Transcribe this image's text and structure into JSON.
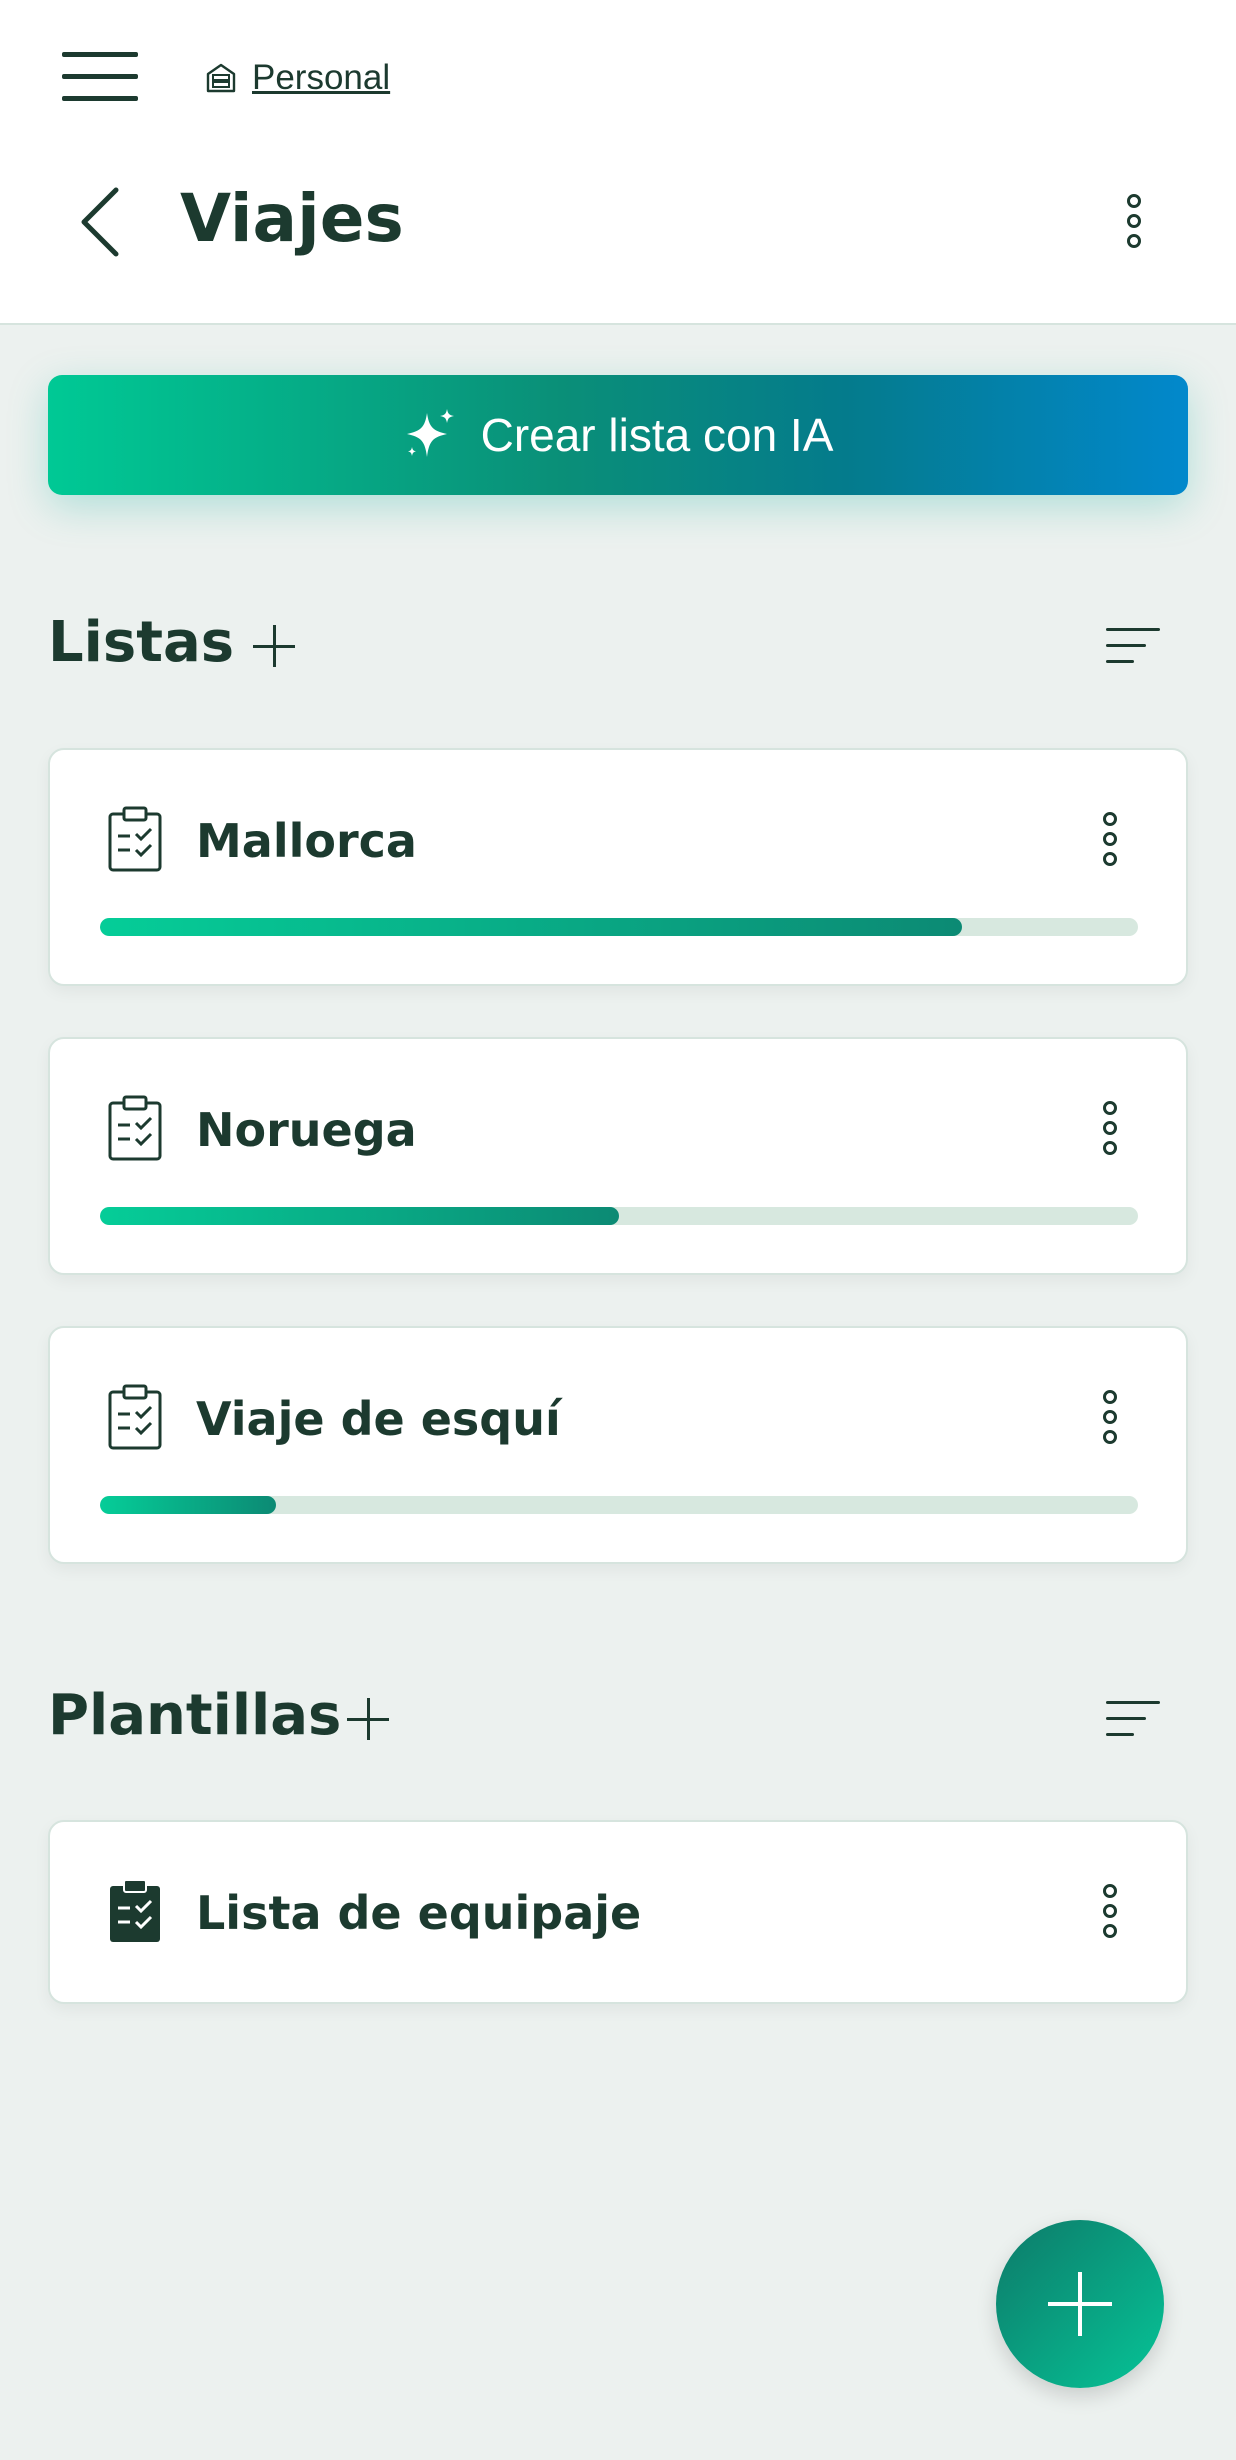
{
  "header": {
    "breadcrumb": "Personal",
    "title": "Viajes"
  },
  "ai_button": {
    "label": "Crear lista con IA",
    "icon": "sparkles-icon"
  },
  "sections": {
    "lists": {
      "title": "Listas",
      "items": [
        {
          "name": "Mallorca",
          "progress": 0.83
        },
        {
          "name": "Noruega",
          "progress": 0.5
        },
        {
          "name": "Viaje de esquí",
          "progress": 0.17
        }
      ]
    },
    "templates": {
      "title": "Plantillas",
      "items": [
        {
          "name": "Lista de equipaje"
        }
      ]
    }
  },
  "colors": {
    "accent": "#00c995",
    "accent_dark": "#0c8a74",
    "ai_gradient_end": "#0288cc",
    "text": "#1c3a2f",
    "background": "#ecf1ef",
    "track": "#d7e8df"
  }
}
